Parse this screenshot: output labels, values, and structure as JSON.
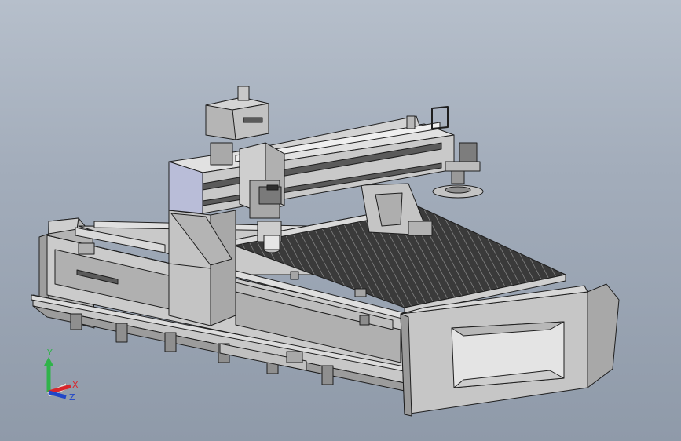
{
  "viewport": {
    "background_top": "#b6bfcb",
    "background_bottom": "#8f9aa9",
    "model_face_light": "#d5d5d5",
    "model_face_mid": "#c2c2c2",
    "model_face_dark": "#9a9a9a",
    "gantry_accent": "#b9bdd8",
    "edge_color": "#1e1e1e"
  },
  "triad": {
    "y_label": "Y",
    "x_label": "X",
    "z_label": "Z",
    "y_color": "#2fb34a",
    "x_color": "#d8262c",
    "z_color": "#2046c8"
  }
}
